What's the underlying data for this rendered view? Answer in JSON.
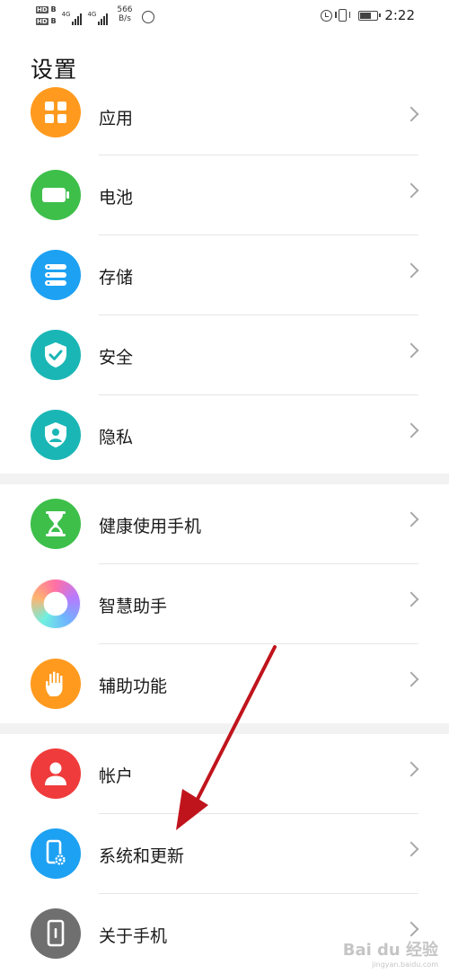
{
  "status_bar": {
    "hd1": "HD",
    "hd2": "HD",
    "sim1_gen": "4G",
    "sim2_gen": "4G",
    "net_speed_value": "566",
    "net_speed_unit": "B/s",
    "time": "2:22",
    "battery_level": 0.7
  },
  "header": {
    "title": "设置"
  },
  "groups": [
    {
      "items": [
        {
          "label": "应用",
          "icon": "apps-icon",
          "color": "#ff9a1f"
        },
        {
          "label": "电池",
          "icon": "battery-icon",
          "color": "#3dbf4a"
        },
        {
          "label": "存储",
          "icon": "storage-icon",
          "color": "#1da1f2"
        },
        {
          "label": "安全",
          "icon": "shield-check-icon",
          "color": "#1ab6b6"
        },
        {
          "label": "隐私",
          "icon": "privacy-icon",
          "color": "#1ab6b6"
        }
      ]
    },
    {
      "items": [
        {
          "label": "健康使用手机",
          "icon": "hourglass-icon",
          "color": "#3dbf4a"
        },
        {
          "label": "智慧助手",
          "icon": "assistant-ring-icon",
          "color": "#b67bff"
        },
        {
          "label": "辅助功能",
          "icon": "hand-icon",
          "color": "#ff9a1f"
        }
      ]
    },
    {
      "items": [
        {
          "label": "帐户",
          "icon": "user-icon",
          "color": "#ef3b3b"
        },
        {
          "label": "系统和更新",
          "icon": "phone-gear-icon",
          "color": "#1da1f2"
        },
        {
          "label": "关于手机",
          "icon": "phone-info-icon",
          "color": "#6f6f6f"
        }
      ]
    }
  ],
  "overlay": {
    "arrow_color": "#c0141c",
    "watermark": "Bai du 经验",
    "watermark_sub": "jingyan.baidu.com"
  }
}
